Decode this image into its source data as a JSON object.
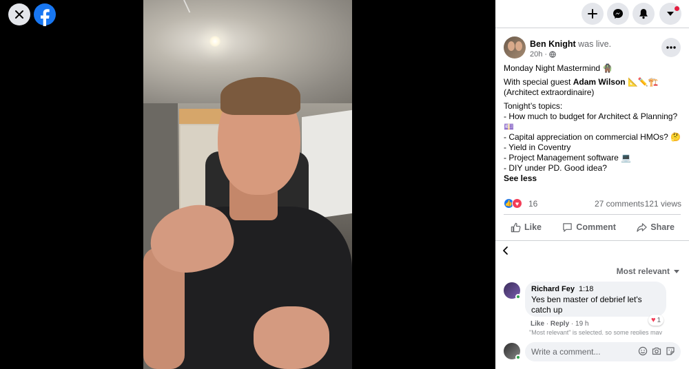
{
  "post": {
    "author": "Ben Knight",
    "status": "was live.",
    "time": "20h ·",
    "lines": {
      "title": "Monday Night Mastermind 🧌",
      "guest_prefix": "With special guest ",
      "guest_name": "Adam Wilson",
      "guest_suffix": " 📐✏️🏗️ (Architect extraordinaire)",
      "topics_heading": "Tonight’s topics:",
      "topic1": "- How much to budget for Architect & Planning?💷",
      "topic2": "- Capital appreciation on commercial HMOs? 🤔",
      "topic3": "- Yield in Coventry",
      "topic4": "- Project Management software 💻",
      "topic5": "- DIY under PD. Good idea?"
    },
    "see_less": "See less",
    "reaction_count": "16",
    "comments_count": "27 comments",
    "views_count": "121 views"
  },
  "actions": {
    "like": "Like",
    "comment": "Comment",
    "share": "Share"
  },
  "comments": {
    "sort_label": "Most relevant",
    "items": [
      {
        "name": "Richard Fey",
        "time": "1:18",
        "text": "Yes ben master of debrief let's catch up",
        "like": "Like",
        "reply": "Reply",
        "age": "19 h",
        "reaction_count": "1"
      }
    ],
    "truncated_notice": "\"Most relevant\" is selected, so some replies may",
    "write_placeholder": "Write a comment..."
  },
  "colors": {
    "brand": "#1877f2",
    "love": "#f33e58",
    "notification": "#e41e3f",
    "online": "#31a24c"
  }
}
